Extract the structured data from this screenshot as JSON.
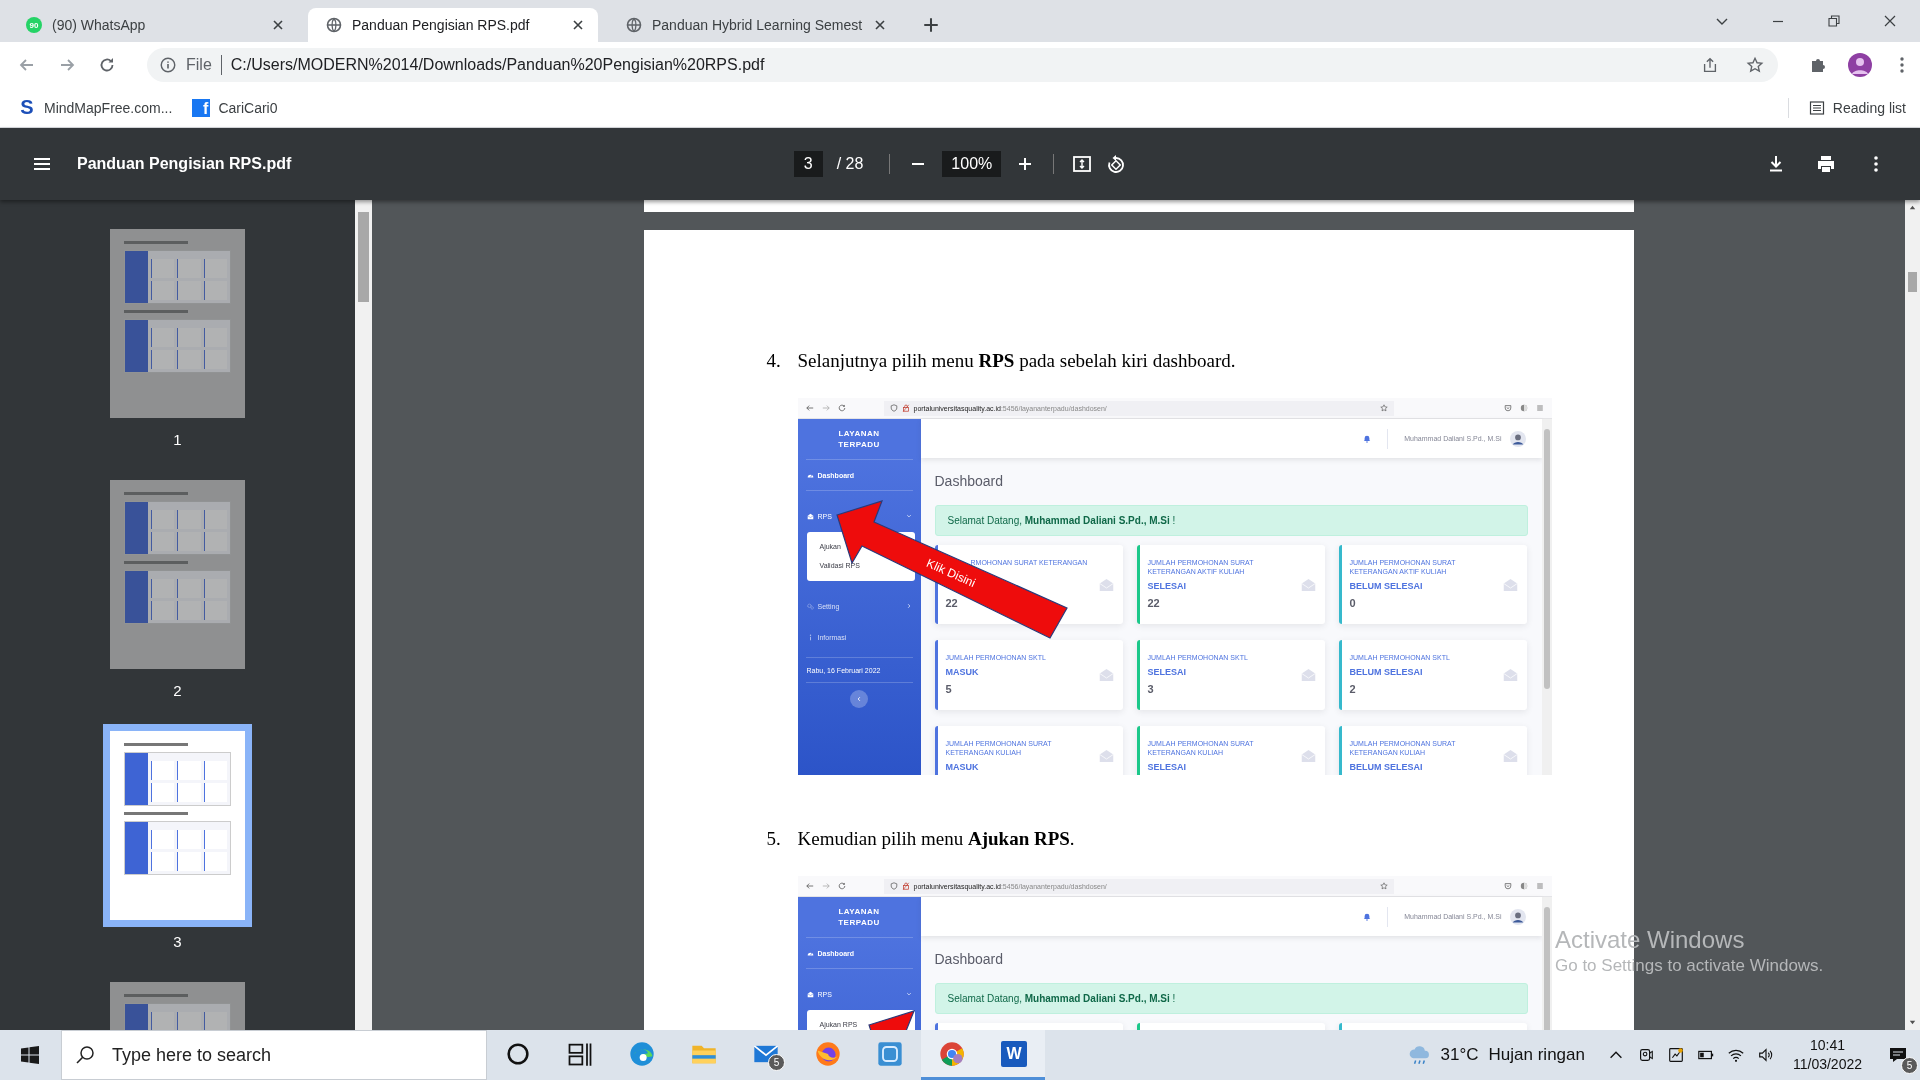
{
  "browser": {
    "tabs": [
      {
        "title": "(90) WhatsApp",
        "kind": "chat",
        "favicon_text": "90",
        "selected": false
      },
      {
        "title": "Panduan Pengisian RPS.pdf",
        "kind": "globe",
        "selected": true
      },
      {
        "title": "Panduan Hybrid Learning Semest",
        "kind": "globe",
        "selected": false
      }
    ],
    "address": {
      "scheme": "File",
      "url": "C:/Users/MODERN%2014/Downloads/Panduan%20Pengisian%20RPS.pdf"
    },
    "bookmarks": [
      {
        "label": "MindMapFree.com...",
        "kind": "s",
        "icon_text": "S"
      },
      {
        "label": "CariCari0",
        "kind": "f",
        "icon_text": "f"
      }
    ],
    "reading_list": "Reading list"
  },
  "pdf_toolbar": {
    "title": "Panduan Pengisian RPS.pdf",
    "page": "3",
    "page_count": "/ 28",
    "zoom": "100%"
  },
  "thumbnails": [
    {
      "label": "1",
      "selected": false
    },
    {
      "label": "2",
      "selected": false
    },
    {
      "label": "3",
      "selected": true
    },
    {
      "selected": false
    }
  ],
  "steps": [
    {
      "number": "4.",
      "text": "Selanjutnya pilih menu **RPS** pada sebelah kiri dashboard.",
      "screenshot": {
        "host": "portaluniversitasquality.ac.id",
        "path": ":5456/layananterpadu/dashdosen/",
        "brand": "LAYANAN TERPADU",
        "user": "Muhammad Daliani S.Pd., M.Si",
        "nav": [
          {
            "kind": "dashboard",
            "label": "Dashboard"
          },
          {
            "kind": "rps",
            "label": "RPS",
            "expanded": true,
            "children": [
              {
                "label": "Ajukan"
              },
              {
                "label": "Validasi RPS"
              }
            ]
          },
          {
            "kind": "setting",
            "label": "Setting",
            "expanded": false
          },
          {
            "kind": "info",
            "label": "Informasi"
          }
        ],
        "date": "Rabu, 16 Februari 2022",
        "collapse_button": true,
        "heading": "Dashboard",
        "welcome": "Selamat Datang, **Muhammad Daliani S.Pd., M.Si** !",
        "cards": [
          {
            "kind": "covered",
            "title": "RMOHONAN SURAT KETERANGAN",
            "value": "22",
            "color": "#4e73df"
          },
          {
            "title": "JUMLAH PERMOHONAN SURAT KETERANGAN AKTIF KULIAH",
            "status": "SELESAI",
            "value": "22",
            "color": "#1cc88a"
          },
          {
            "title": "JUMLAH PERMOHONAN SURAT KETERANGAN AKTIF KULIAH",
            "status": "BELUM SELESAI",
            "value": "0",
            "color": "#36b9cc"
          },
          {
            "title": "JUMLAH PERMOHONAN SKTL",
            "status": "MASUK",
            "value": "5",
            "color": "#4e73df"
          },
          {
            "title": "JUMLAH PERMOHONAN SKTL",
            "status": "SELESAI",
            "value": "3",
            "color": "#1cc88a"
          },
          {
            "title": "JUMLAH PERMOHONAN SKTL",
            "status": "BELUM SELESAI",
            "value": "2",
            "color": "#36b9cc"
          },
          {
            "title": "JUMLAH PERMOHONAN SURAT KETERANGAN KULIAH",
            "status": "MASUK",
            "color": "#4e73df"
          },
          {
            "title": "JUMLAH PERMOHONAN SURAT KETERANGAN KULIAH",
            "status": "SELESAI",
            "color": "#1cc88a"
          },
          {
            "title": "JUMLAH PERMOHONAN SURAT KETERANGAN KULIAH",
            "status": "BELUM SELESAI",
            "color": "#36b9cc"
          }
        ],
        "arrow": {
          "kind": "full",
          "label": "Klik Disini"
        }
      }
    },
    {
      "number": "5.",
      "text": "Kemudian pilih menu **Ajukan RPS**.",
      "screenshot": {
        "host": "portaluniversitasquality.ac.id",
        "path": ":5456/layananterpadu/dashdosen/",
        "brand": "LAYANAN TERPADU",
        "user": "Muhammad Daliani S.Pd., M.Si",
        "nav": [
          {
            "kind": "dashboard",
            "label": "Dashboard"
          },
          {
            "kind": "rps",
            "label": "RPS",
            "expanded": true,
            "children": [
              {
                "label": "Ajukan RPS"
              }
            ]
          }
        ],
        "heading": "Dashboard",
        "welcome": "Selamat Datang, **Muhammad Daliani S.Pd., M.Si** !",
        "cards": [
          {
            "color": "#4e73df"
          },
          {
            "color": "#1cc88a"
          },
          {
            "color": "#36b9cc"
          }
        ],
        "arrow": {
          "kind": "tip"
        }
      }
    }
  ],
  "taskbar": {
    "search_placeholder": "Type here to search",
    "apps": [
      {
        "kind": "cortana",
        "active": false
      },
      {
        "kind": "taskview",
        "active": false
      },
      {
        "kind": "edge",
        "active": false
      },
      {
        "kind": "explorer",
        "active": false
      },
      {
        "kind": "mail",
        "active": false,
        "badge": "5"
      },
      {
        "kind": "firefox",
        "active": false
      },
      {
        "kind": "app",
        "active": false
      },
      {
        "kind": "chrome",
        "active": true
      },
      {
        "kind": "word",
        "active": true,
        "icon_text": "W"
      }
    ],
    "temperature": "31°C",
    "weather": "Hujan ringan",
    "time": "10:41",
    "date": "11/03/2022",
    "notifications": "5"
  },
  "activation_notice": {
    "title": "Activate Windows",
    "text": "Go to Settings to activate Windows."
  }
}
